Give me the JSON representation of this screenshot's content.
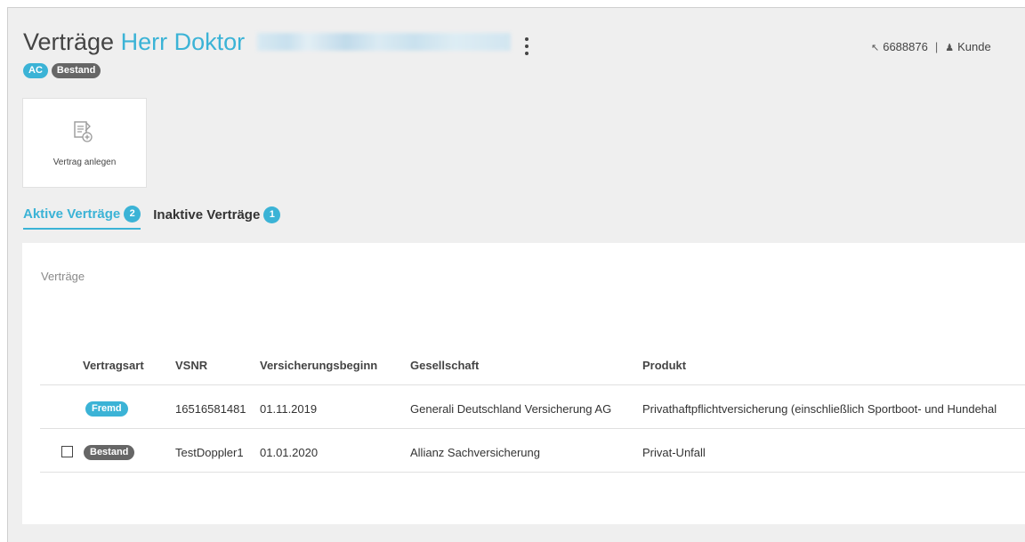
{
  "header": {
    "title_prefix": "Verträge",
    "salutation": "Herr Doktor",
    "customer_id": "6688876",
    "separator": "|",
    "role_label": "Kunde"
  },
  "badges": [
    "AC",
    "Bestand"
  ],
  "actions": {
    "create_contract_label": "Vertrag anlegen"
  },
  "tabs": [
    {
      "label": "Aktive Verträge",
      "count": "2"
    },
    {
      "label": "Inaktive Verträge",
      "count": "1"
    }
  ],
  "table": {
    "title": "Verträge",
    "columns": [
      "Vertragsart",
      "VSNR",
      "Versicherungsbeginn",
      "Gesellschaft",
      "Produkt"
    ],
    "rows": [
      {
        "type": "Fremd",
        "vsnr": "16516581481",
        "start": "01.11.2019",
        "company": "Generali Deutschland Versicherung AG",
        "product": "Privathaftpflichtversicherung (einschließlich Sportboot- und Hundehal"
      },
      {
        "type": "Bestand",
        "vsnr": "TestDoppler1",
        "start": "01.01.2020",
        "company": "Allianz Sachversicherung",
        "product": "Privat-Unfall"
      }
    ]
  },
  "colors": {
    "accent": "#3bb3d6",
    "badge_dark": "#666666",
    "background": "#efefef"
  }
}
